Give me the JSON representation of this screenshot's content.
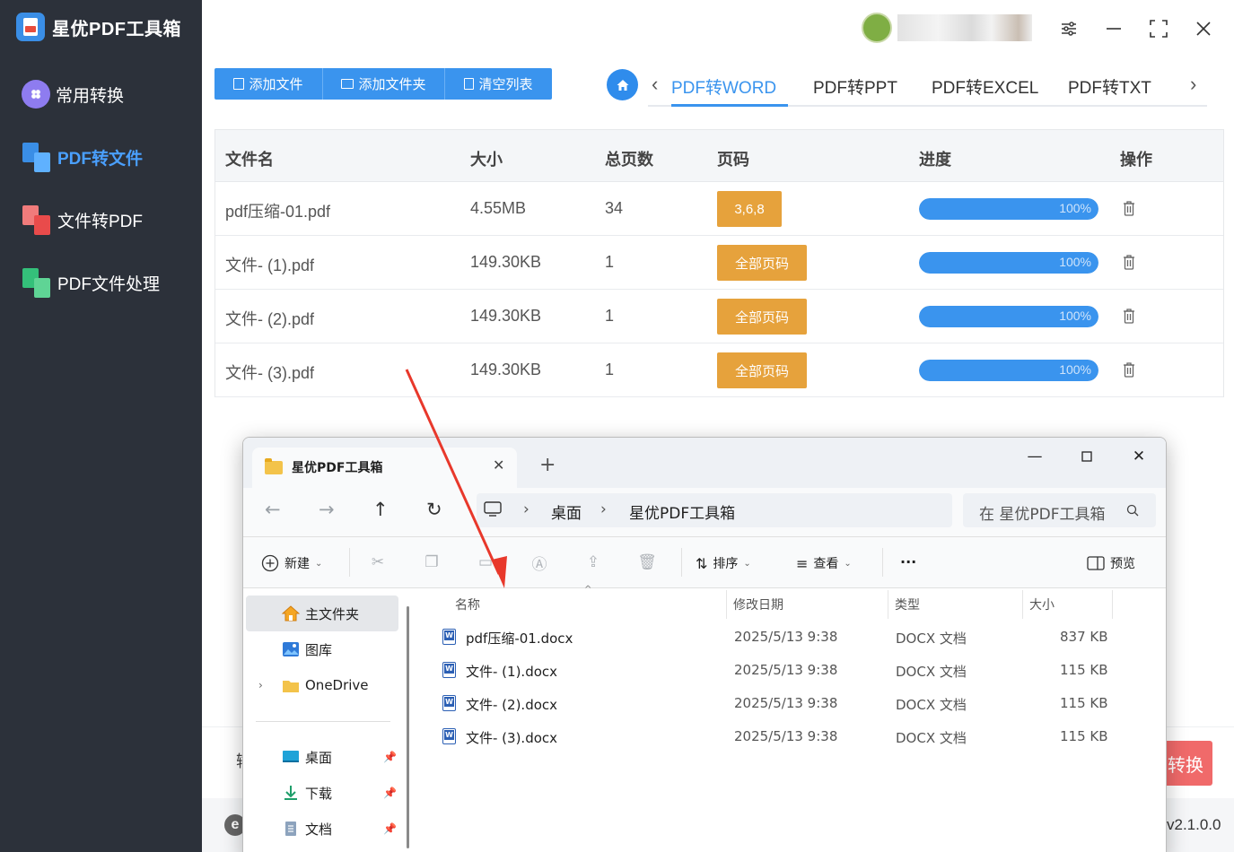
{
  "app": {
    "title": "星优PDF工具箱",
    "sidebar": [
      {
        "label": "常用转换",
        "active": false
      },
      {
        "label": "PDF转文件",
        "active": true
      },
      {
        "label": "文件转PDF",
        "active": false
      },
      {
        "label": "PDF文件处理",
        "active": false
      }
    ],
    "toolbar": {
      "add_file": "添加文件",
      "add_folder": "添加文件夹",
      "clear_list": "清空列表"
    },
    "tabs": [
      {
        "label": "PDF转WORD",
        "active": true
      },
      {
        "label": "PDF转PPT",
        "active": false
      },
      {
        "label": "PDF转EXCEL",
        "active": false
      },
      {
        "label": "PDF转TXT",
        "active": false
      }
    ],
    "table": {
      "headers": [
        "文件名",
        "大小",
        "总页数",
        "页码",
        "进度",
        "操作"
      ],
      "rows": [
        {
          "name": "pdf压缩-01.pdf",
          "size": "4.55MB",
          "pages": "34",
          "page_range": "3,6,8",
          "progress": 1.0,
          "progress_label": "100%"
        },
        {
          "name": "文件- (1).pdf",
          "size": "149.30KB",
          "pages": "1",
          "page_range": "全部页码",
          "progress": 1.0,
          "progress_label": "100%"
        },
        {
          "name": "文件- (2).pdf",
          "size": "149.30KB",
          "pages": "1",
          "page_range": "全部页码",
          "progress": 1.0,
          "progress_label": "100%"
        },
        {
          "name": "文件- (3).pdf",
          "size": "149.30KB",
          "pages": "1",
          "page_range": "全部页码",
          "progress": 1.0,
          "progress_label": "100%"
        }
      ]
    },
    "convert_button": "转换",
    "version": "v2.1.0.0",
    "colors": {
      "accent": "#3a94ee",
      "sidebar": "#2c313a",
      "page_button": "#e6a23c",
      "convert": "#f06a6a",
      "arrow": "#e8382b"
    }
  },
  "explorer": {
    "tab_title": "星优PDF工具箱",
    "breadcrumb": [
      "桌面",
      "星优PDF工具箱"
    ],
    "search_placeholder": "在 星优PDF工具箱",
    "commands": {
      "new": "新建",
      "sort": "排序",
      "view": "查看",
      "more": "...",
      "preview": "预览"
    },
    "nav": {
      "home": "主文件夹",
      "gallery": "图库",
      "onedrive": "OneDrive",
      "desktop": "桌面",
      "downloads": "下载",
      "documents": "文档"
    },
    "columns": [
      "名称",
      "修改日期",
      "类型",
      "大小"
    ],
    "files": [
      {
        "name": "pdf压缩-01.docx",
        "date": "2025/5/13 9:38",
        "type": "DOCX 文档",
        "size": "837 KB"
      },
      {
        "name": "文件- (1).docx",
        "date": "2025/5/13 9:38",
        "type": "DOCX 文档",
        "size": "115 KB"
      },
      {
        "name": "文件- (2).docx",
        "date": "2025/5/13 9:38",
        "type": "DOCX 文档",
        "size": "115 KB"
      },
      {
        "name": "文件- (3).docx",
        "date": "2025/5/13 9:38",
        "type": "DOCX 文档",
        "size": "115 KB"
      }
    ]
  }
}
